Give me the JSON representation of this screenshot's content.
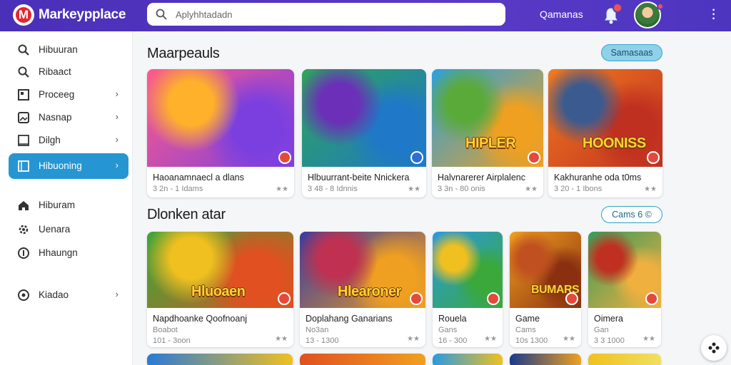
{
  "header": {
    "brand": "Markeypplace",
    "logo_letter": "M",
    "search_placeholder": "Aplyhhtadadn",
    "link": "Qamanas",
    "bell_icon": "bell-icon",
    "menu_icon": "kebab-icon"
  },
  "sidebar": {
    "items": [
      {
        "label": "Hibuuran",
        "icon": "search-icon",
        "chevron": false,
        "active": false
      },
      {
        "label": "Ribaact",
        "icon": "search-icon",
        "chevron": false,
        "active": false
      },
      {
        "label": "Proceeg",
        "icon": "grid-icon",
        "chevron": true,
        "active": false
      },
      {
        "label": "Nasnap",
        "icon": "image-icon",
        "chevron": true,
        "active": false
      },
      {
        "label": "Dilgh",
        "icon": "square-icon",
        "chevron": true,
        "active": false
      },
      {
        "label": "Hibuoning",
        "icon": "square-icon",
        "chevron": true,
        "active": true
      },
      {
        "label": "Hiburam",
        "icon": "home-icon",
        "chevron": false,
        "active": false
      },
      {
        "label": "Uenara",
        "icon": "gear-icon",
        "chevron": false,
        "active": false
      },
      {
        "label": "Hhaungn",
        "icon": "info-icon",
        "chevron": false,
        "active": false
      },
      {
        "label": "Kiadao",
        "icon": "circle-icon",
        "chevron": true,
        "active": false
      }
    ]
  },
  "sections": [
    {
      "title": "Maarpeauls",
      "button": "Samasaas",
      "cards": [
        {
          "title": "Haoanamnaecl a dlans",
          "sub": "3 2n - 1 Idams",
          "thumb_label": "",
          "colors": [
            "#ff5a8a",
            "#ffb12b",
            "#7b3fe0"
          ]
        },
        {
          "title": "Hlbuurrant-beite Nnickera",
          "sub": "3 48 - 8 Idnnis",
          "thumb_label": "",
          "colors": [
            "#2fa35a",
            "#6b2fb8",
            "#1f78c8"
          ]
        },
        {
          "title": "Halvnarerer Airplalenc",
          "sub": "3 3n - 80 onis",
          "thumb_label": "HIPLER",
          "colors": [
            "#2aa0e0",
            "#5aaa3a",
            "#f0a020"
          ]
        },
        {
          "title": "Kakhuranhe oda t0ms",
          "sub": "3 20 - 1 Ibons",
          "thumb_label": "HOONISS",
          "colors": [
            "#f07a20",
            "#3a5a90",
            "#c03020"
          ]
        }
      ]
    },
    {
      "title": "Dlonken atar",
      "button": "Cams 6 ©",
      "cards": [
        {
          "title": "Napdhoanke Qoofnoanj",
          "sub": "Boabot",
          "sub2": "101 - 3oon",
          "thumb_label": "Hluoaen",
          "colors": [
            "#3aa83a",
            "#f0c020",
            "#e05020"
          ]
        },
        {
          "title": "Doplahang Ganarians",
          "sub": "No3an",
          "sub2": "13 - 1300",
          "thumb_label": "Hlearoner",
          "colors": [
            "#3a3aa0",
            "#c03050",
            "#f0a020"
          ]
        },
        {
          "title": "Rouela",
          "sub": "Gans",
          "sub2": "16 - 300",
          "thumb_label": "",
          "colors": [
            "#2a9ae0",
            "#f0c020",
            "#3aa83a"
          ]
        },
        {
          "title": "Game",
          "sub": "Cams",
          "sub2": "10s 1300",
          "thumb_label": "BUMARS",
          "colors": [
            "#f0a020",
            "#c05020",
            "#8a3010"
          ]
        },
        {
          "title": "Oimera",
          "sub": "Gan",
          "sub2": "3 3 1000",
          "thumb_label": "",
          "colors": [
            "#3a9a5a",
            "#c03020",
            "#f0b040"
          ]
        }
      ]
    }
  ],
  "card_rating": "★★",
  "fab_icon": "gamepad-icon"
}
